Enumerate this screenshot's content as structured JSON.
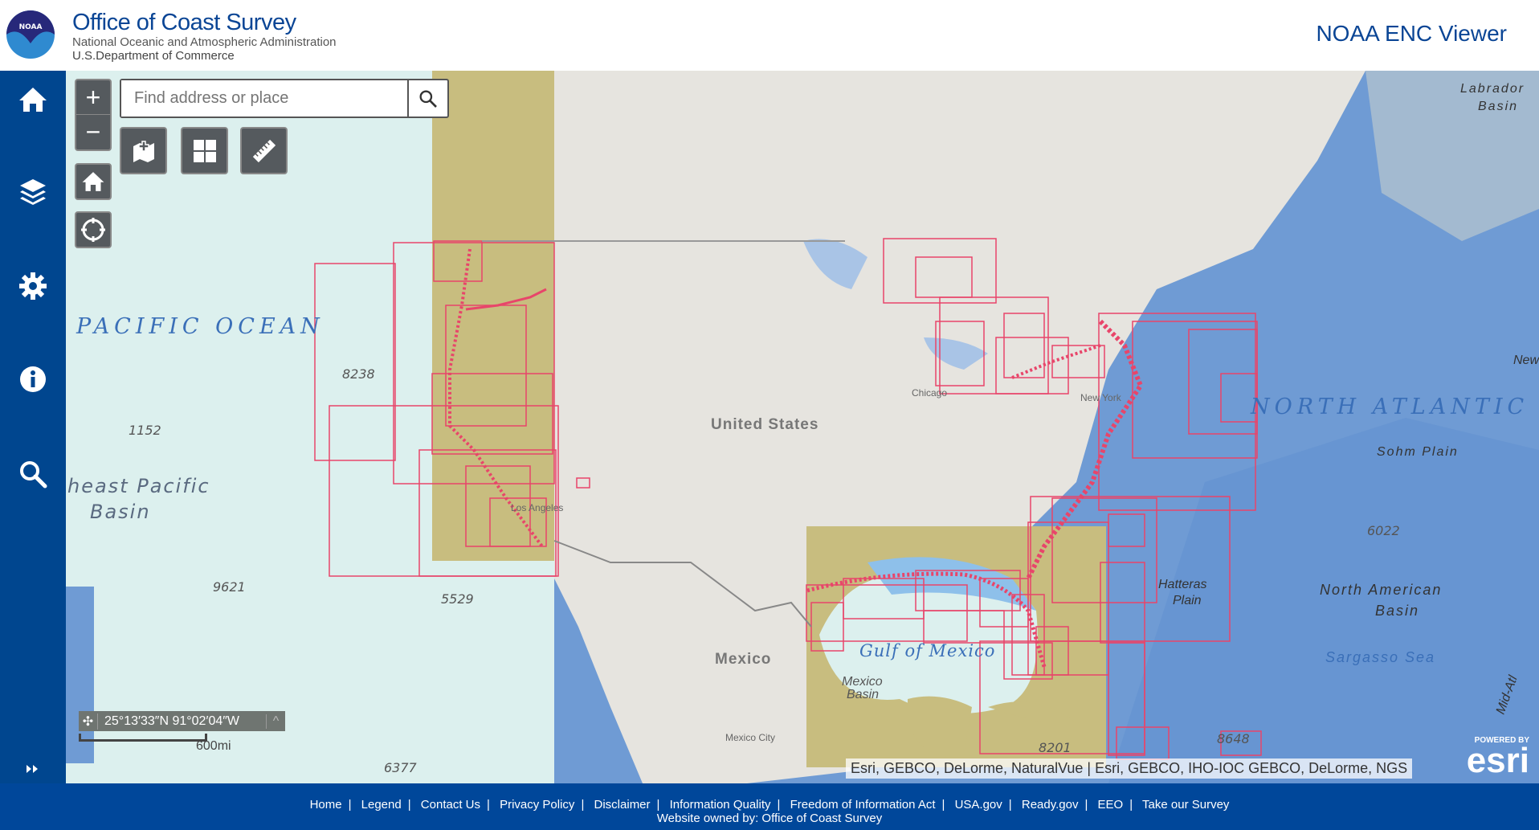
{
  "header": {
    "title": "Office of Coast Survey",
    "subtitle1": "National Oceanic and Atmospheric Administration",
    "subtitle2": "U.S.Department of Commerce",
    "logo_text": "NOAA",
    "app_title": "NOAA ENC Viewer"
  },
  "sidebar": {
    "items": [
      {
        "icon": "home-icon"
      },
      {
        "icon": "layers-icon"
      },
      {
        "icon": "gear-icon"
      },
      {
        "icon": "info-icon"
      },
      {
        "icon": "search-icon"
      },
      {
        "icon": "expand-icon"
      }
    ]
  },
  "map": {
    "search": {
      "placeholder": "Find address or place",
      "value": ""
    },
    "zoom_in": "+",
    "zoom_out": "−",
    "coordinates": "25°13′33″N 91°02′04″W",
    "scale": "600mi",
    "attribution": "Esri, GEBCO, DeLorme, NaturalVue | Esri, GEBCO, IHO-IOC GEBCO, DeLorme, NGS",
    "esri": {
      "powered": "POWERED BY",
      "logo": "esri"
    },
    "labels": {
      "pacific": "PACIFIC OCEAN",
      "atlantic": "NORTH ATLANTIC",
      "ne_pacific_1": "heast Pacific",
      "ne_pacific_2": "Basin",
      "us": "United States",
      "mexico": "Mexico",
      "gulf": "Gulf of Mexico",
      "mexico_basin_1": "Mexico",
      "mexico_basin_2": "Basin",
      "hatteras_1": "Hatteras",
      "hatteras_2": "Plain",
      "na_basin_1": "North American",
      "na_basin_2": "Basin",
      "sargasso": "Sargasso Sea",
      "sohm": "Sohm Plain",
      "labrador_1": "Labrador",
      "labrador_2": "Basin",
      "chicago": "Chicago",
      "new_york": "New York",
      "los_angeles": "Los Angeles",
      "mexico_city": "Mexico City",
      "mid_atlantic": "Mid-Atl",
      "new": "New"
    },
    "depths": [
      "8238",
      "1152",
      "9621",
      "5529",
      "6377",
      "6022",
      "8201",
      "8648"
    ]
  },
  "colors": {
    "brand": "#00479a",
    "chart_outline": "#e8456a",
    "chart_fill": "#c8bd7f",
    "ocean": "#6f9bd4",
    "land": "#e6e4df"
  },
  "footer": {
    "links": [
      "Home",
      "Legend",
      "Contact Us",
      "Privacy Policy",
      "Disclaimer",
      "Information Quality",
      "Freedom of Information Act",
      "USA.gov",
      "Ready.gov",
      "EEO",
      "Take our Survey"
    ],
    "owned": "Website owned by: Office of Coast Survey"
  }
}
